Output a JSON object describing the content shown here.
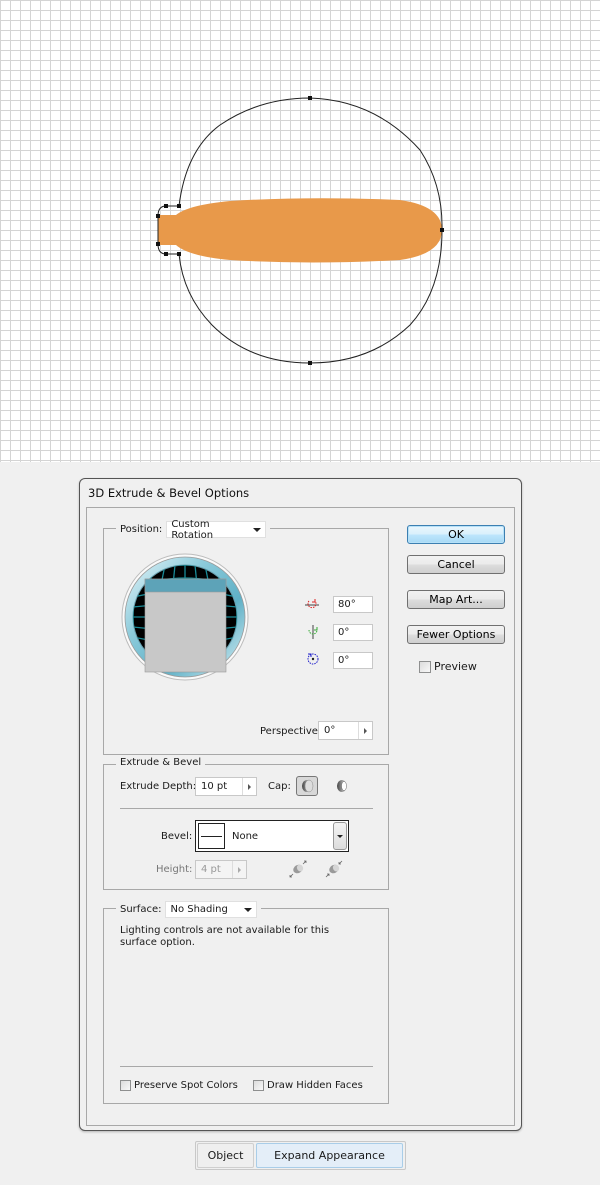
{
  "canvas": {
    "artwork": {
      "shape_fill": "#e8994a",
      "path_stroke": "#222222",
      "description": "bulb outline path with selected anchor points and orange elongated shape"
    }
  },
  "dialog": {
    "title": "3D Extrude & Bevel Options",
    "position": {
      "label": "Position:",
      "preset": "Custom Rotation",
      "rotation_x": "80°",
      "rotation_y": "0°",
      "rotation_z": "0°",
      "perspective_label": "Perspective:",
      "perspective": "0°"
    },
    "extrude_bevel": {
      "legend": "Extrude & Bevel",
      "extrude_depth_label": "Extrude Depth:",
      "extrude_depth": "10 pt",
      "cap_label": "Cap:",
      "bevel_label": "Bevel:",
      "bevel": "None",
      "height_label": "Height:",
      "height": "4 pt"
    },
    "surface": {
      "label": "Surface:",
      "value": "No Shading",
      "message": "Lighting controls are not available for this surface option.",
      "preserve_spot_colors_label": "Preserve Spot Colors",
      "preserve_spot_colors": false,
      "draw_hidden_faces_label": "Draw Hidden Faces",
      "draw_hidden_faces": false
    },
    "buttons": {
      "ok": "OK",
      "cancel": "Cancel",
      "map_art": "Map Art...",
      "fewer_options": "Fewer Options",
      "preview_label": "Preview",
      "preview": false
    }
  },
  "toolbar": {
    "object": "Object",
    "expand_appearance": "Expand Appearance"
  },
  "colors": {
    "accent": "#3c7fb1",
    "orb_grid": "#1a8a96",
    "orb_face": "#c8c8c8",
    "orb_top": "#5da3b8"
  }
}
